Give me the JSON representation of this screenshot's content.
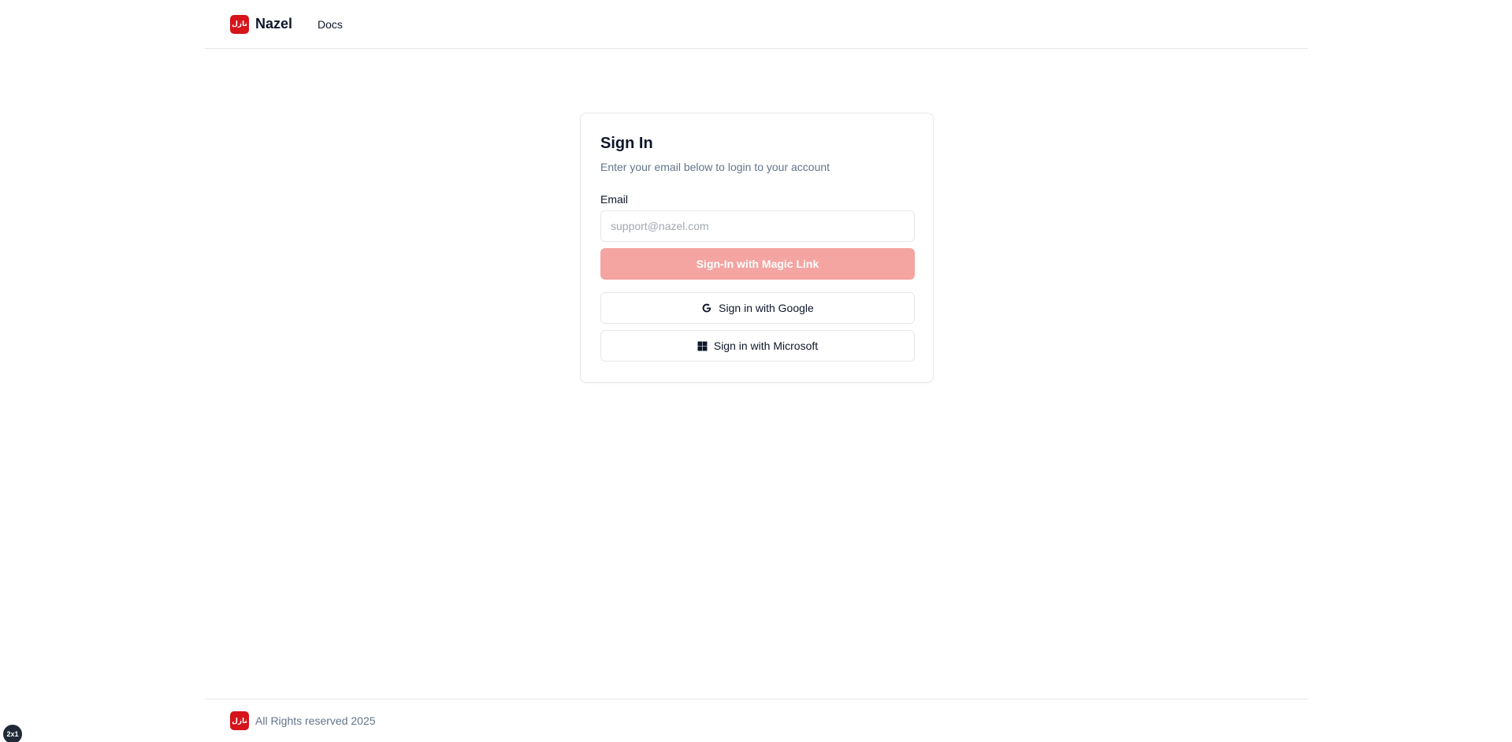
{
  "header": {
    "logo_text": "نازل",
    "brand": "Nazel",
    "nav": [
      {
        "label": "Docs"
      }
    ]
  },
  "card": {
    "title": "Sign In",
    "subtitle": "Enter your email below to login to your account",
    "email_label": "Email",
    "email_value": "",
    "email_placeholder": "support@nazel.com",
    "magic_link_label": "Sign-In with Magic Link",
    "google_label": "Sign in with Google",
    "microsoft_label": "Sign in with Microsoft"
  },
  "footer": {
    "logo_text": "نازل",
    "copyright": "All Rights reserved 2025"
  },
  "corner_badge": "2x1",
  "colors": {
    "brand_red": "#d6141b",
    "primary_button_disabled": "#f4a4a1",
    "border": "#e5e7eb",
    "muted_text": "#64748b"
  },
  "icons": {
    "google": "google-icon",
    "microsoft": "microsoft-icon"
  }
}
